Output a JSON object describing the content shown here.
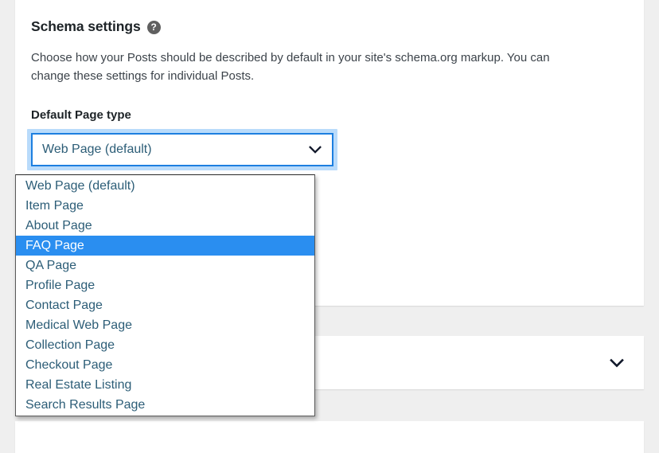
{
  "panel": {
    "heading": "Schema settings",
    "help_icon": "help-circle-icon",
    "help_glyph": "?",
    "description": "Choose how your Posts should be described by default in your site's schema.org markup. You can change these settings for individual Posts.",
    "field_label": "Default Page type"
  },
  "select": {
    "name": "default-page-type",
    "value": "Web Page (default)",
    "expanded": true,
    "icon": "chevron-down-icon",
    "options": [
      "Web Page (default)",
      "Item Page",
      "About Page",
      "FAQ Page",
      "QA Page",
      "Profile Page",
      "Contact Page",
      "Medical Web Page",
      "Collection Page",
      "Checkout Page",
      "Real Estate Listing",
      "Search Results Page"
    ],
    "highlighted_option": "FAQ Page"
  },
  "second_panel": {
    "toggle_icon": "chevron-down-icon"
  },
  "colors": {
    "page_background": "#efefef",
    "card_background": "#ffffff",
    "heading_text": "#1d2327",
    "body_text": "#3c434a",
    "option_text": "#2c5d77",
    "focus_ring": "#b9dbfb",
    "select_border": "#1d7fe0",
    "highlight": "#2a8ef0",
    "highlight_text": "#ffffff"
  }
}
